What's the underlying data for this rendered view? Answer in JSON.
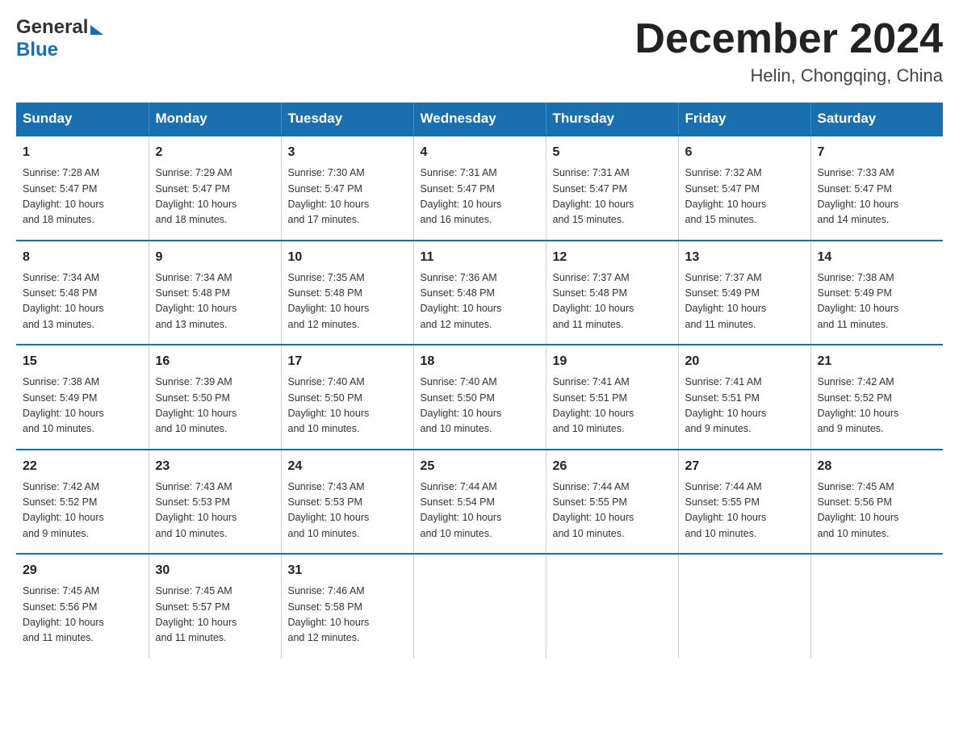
{
  "header": {
    "logo_general": "General",
    "logo_blue": "Blue",
    "month_title": "December 2024",
    "location": "Helin, Chongqing, China"
  },
  "days_of_week": [
    "Sunday",
    "Monday",
    "Tuesday",
    "Wednesday",
    "Thursday",
    "Friday",
    "Saturday"
  ],
  "weeks": [
    [
      {
        "day": "1",
        "sunrise": "7:28 AM",
        "sunset": "5:47 PM",
        "daylight": "10 hours and 18 minutes."
      },
      {
        "day": "2",
        "sunrise": "7:29 AM",
        "sunset": "5:47 PM",
        "daylight": "10 hours and 18 minutes."
      },
      {
        "day": "3",
        "sunrise": "7:30 AM",
        "sunset": "5:47 PM",
        "daylight": "10 hours and 17 minutes."
      },
      {
        "day": "4",
        "sunrise": "7:31 AM",
        "sunset": "5:47 PM",
        "daylight": "10 hours and 16 minutes."
      },
      {
        "day": "5",
        "sunrise": "7:31 AM",
        "sunset": "5:47 PM",
        "daylight": "10 hours and 15 minutes."
      },
      {
        "day": "6",
        "sunrise": "7:32 AM",
        "sunset": "5:47 PM",
        "daylight": "10 hours and 15 minutes."
      },
      {
        "day": "7",
        "sunrise": "7:33 AM",
        "sunset": "5:47 PM",
        "daylight": "10 hours and 14 minutes."
      }
    ],
    [
      {
        "day": "8",
        "sunrise": "7:34 AM",
        "sunset": "5:48 PM",
        "daylight": "10 hours and 13 minutes."
      },
      {
        "day": "9",
        "sunrise": "7:34 AM",
        "sunset": "5:48 PM",
        "daylight": "10 hours and 13 minutes."
      },
      {
        "day": "10",
        "sunrise": "7:35 AM",
        "sunset": "5:48 PM",
        "daylight": "10 hours and 12 minutes."
      },
      {
        "day": "11",
        "sunrise": "7:36 AM",
        "sunset": "5:48 PM",
        "daylight": "10 hours and 12 minutes."
      },
      {
        "day": "12",
        "sunrise": "7:37 AM",
        "sunset": "5:48 PM",
        "daylight": "10 hours and 11 minutes."
      },
      {
        "day": "13",
        "sunrise": "7:37 AM",
        "sunset": "5:49 PM",
        "daylight": "10 hours and 11 minutes."
      },
      {
        "day": "14",
        "sunrise": "7:38 AM",
        "sunset": "5:49 PM",
        "daylight": "10 hours and 11 minutes."
      }
    ],
    [
      {
        "day": "15",
        "sunrise": "7:38 AM",
        "sunset": "5:49 PM",
        "daylight": "10 hours and 10 minutes."
      },
      {
        "day": "16",
        "sunrise": "7:39 AM",
        "sunset": "5:50 PM",
        "daylight": "10 hours and 10 minutes."
      },
      {
        "day": "17",
        "sunrise": "7:40 AM",
        "sunset": "5:50 PM",
        "daylight": "10 hours and 10 minutes."
      },
      {
        "day": "18",
        "sunrise": "7:40 AM",
        "sunset": "5:50 PM",
        "daylight": "10 hours and 10 minutes."
      },
      {
        "day": "19",
        "sunrise": "7:41 AM",
        "sunset": "5:51 PM",
        "daylight": "10 hours and 10 minutes."
      },
      {
        "day": "20",
        "sunrise": "7:41 AM",
        "sunset": "5:51 PM",
        "daylight": "10 hours and 9 minutes."
      },
      {
        "day": "21",
        "sunrise": "7:42 AM",
        "sunset": "5:52 PM",
        "daylight": "10 hours and 9 minutes."
      }
    ],
    [
      {
        "day": "22",
        "sunrise": "7:42 AM",
        "sunset": "5:52 PM",
        "daylight": "10 hours and 9 minutes."
      },
      {
        "day": "23",
        "sunrise": "7:43 AM",
        "sunset": "5:53 PM",
        "daylight": "10 hours and 10 minutes."
      },
      {
        "day": "24",
        "sunrise": "7:43 AM",
        "sunset": "5:53 PM",
        "daylight": "10 hours and 10 minutes."
      },
      {
        "day": "25",
        "sunrise": "7:44 AM",
        "sunset": "5:54 PM",
        "daylight": "10 hours and 10 minutes."
      },
      {
        "day": "26",
        "sunrise": "7:44 AM",
        "sunset": "5:55 PM",
        "daylight": "10 hours and 10 minutes."
      },
      {
        "day": "27",
        "sunrise": "7:44 AM",
        "sunset": "5:55 PM",
        "daylight": "10 hours and 10 minutes."
      },
      {
        "day": "28",
        "sunrise": "7:45 AM",
        "sunset": "5:56 PM",
        "daylight": "10 hours and 10 minutes."
      }
    ],
    [
      {
        "day": "29",
        "sunrise": "7:45 AM",
        "sunset": "5:56 PM",
        "daylight": "10 hours and 11 minutes."
      },
      {
        "day": "30",
        "sunrise": "7:45 AM",
        "sunset": "5:57 PM",
        "daylight": "10 hours and 11 minutes."
      },
      {
        "day": "31",
        "sunrise": "7:46 AM",
        "sunset": "5:58 PM",
        "daylight": "10 hours and 12 minutes."
      },
      null,
      null,
      null,
      null
    ]
  ],
  "labels": {
    "sunrise": "Sunrise:",
    "sunset": "Sunset:",
    "daylight": "Daylight:"
  }
}
